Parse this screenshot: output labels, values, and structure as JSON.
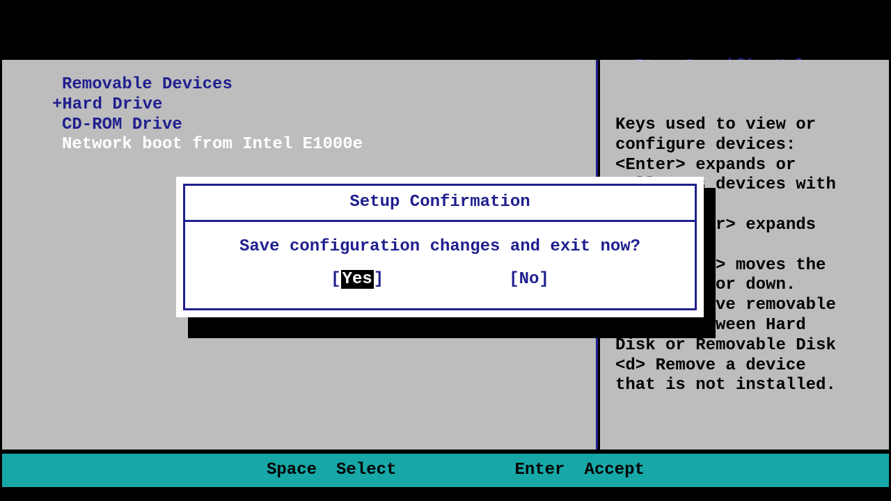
{
  "help": {
    "title_cut": "Item Specific Help",
    "body": "Keys used to view or\nconfigure devices:\n<Enter> expands or\ncollapses devices with\na + or -\n<Ctrl+Enter> expands\nall\n<+> and <-> moves the\ndevice up or down.\n<n> May move removable\ndevice between Hard\nDisk or Removable Disk\n<d> Remove a device\nthat is not installed."
  },
  "boot": {
    "items": [
      {
        "label": "Removable Devices",
        "prefix": " "
      },
      {
        "label": "Hard Drive",
        "prefix": "+"
      },
      {
        "label": "CD-ROM Drive",
        "prefix": " "
      },
      {
        "label": "Network boot from Intel E1000e",
        "prefix": " ",
        "selected": true
      }
    ]
  },
  "modal": {
    "title": "Setup Confirmation",
    "message": "Save configuration changes and exit now?",
    "yes": "Yes",
    "no": "No"
  },
  "footer": {
    "key1": "Space",
    "label1": "Select",
    "key2": "Enter",
    "label2": "Accept"
  }
}
